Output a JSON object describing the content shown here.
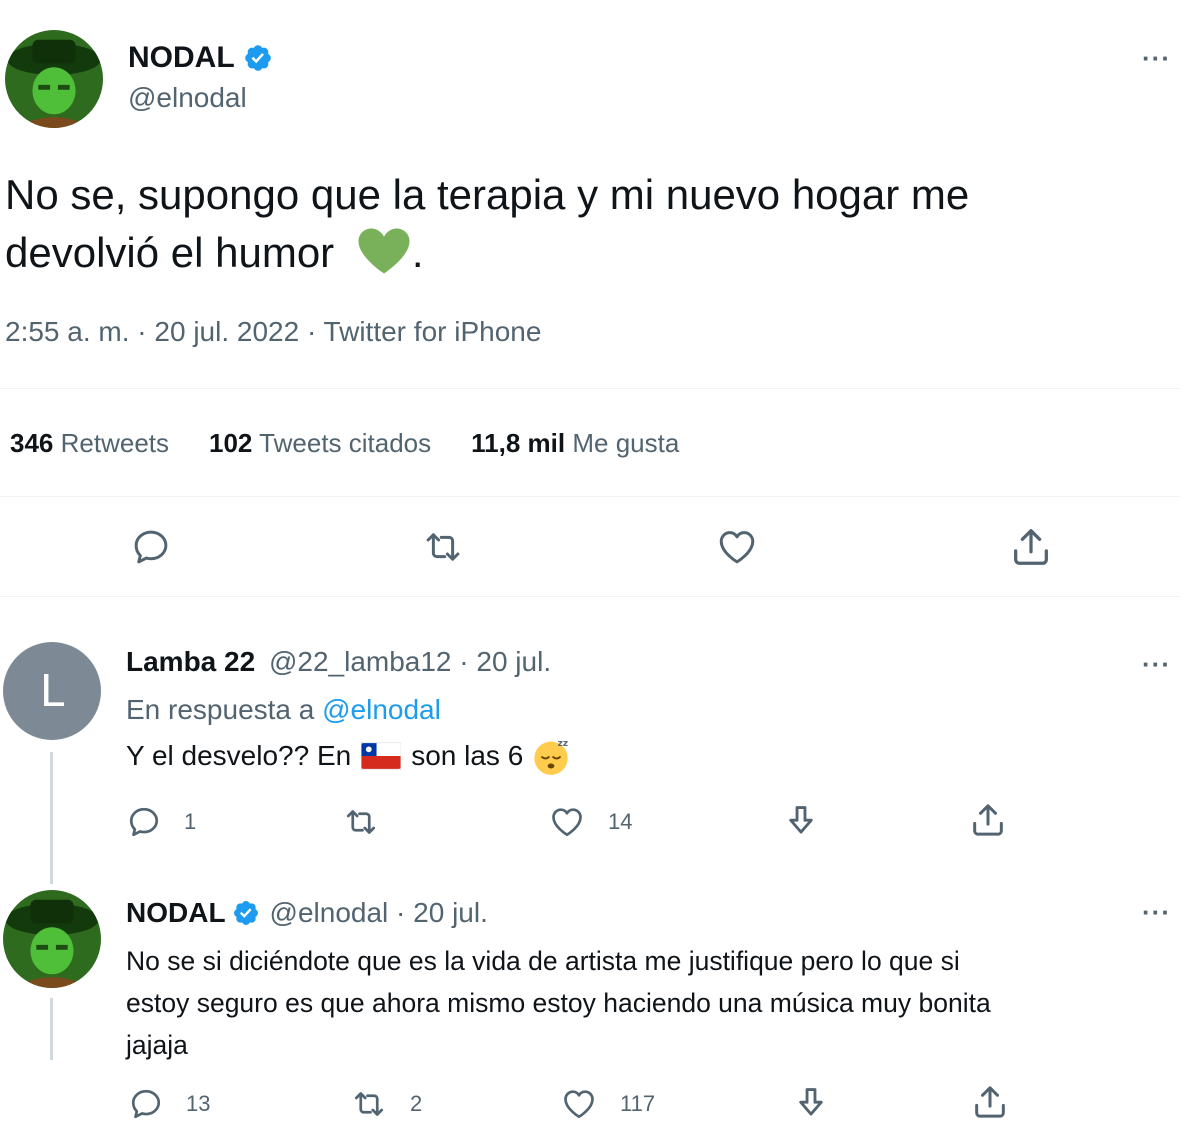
{
  "main_tweet": {
    "display_name": "NODAL",
    "handle": "@elnodal",
    "text_line1": "No se, supongo que la terapia y mi nuevo hogar me",
    "text_line2": "devolvió el humor",
    "text_emoji": "green-heart",
    "text_end": ".",
    "meta": "2:55 a. m. · 20 jul. 2022 · Twitter for iPhone",
    "stats": {
      "retweets_count": "346",
      "retweets_label": "Retweets",
      "quotes_count": "102",
      "quotes_label": "Tweets citados",
      "likes_count": "11,8 mil",
      "likes_label": "Me gusta"
    },
    "actions": [
      "reply-icon",
      "retweet-icon",
      "like-icon",
      "share-icon"
    ]
  },
  "reply1": {
    "avatar_letter": "L",
    "display_name": "Lamba 22",
    "handle_date": "@22_lamba12 · 20 jul.",
    "reply_prefix": "En respuesta a",
    "reply_to": "@elnodal",
    "text_a": "Y el desvelo?? En",
    "text_flag": "chile-flag",
    "text_b": "son las 6",
    "text_emoji": "sleeping-face",
    "reply_count": "1",
    "retweet_count": "",
    "like_count": "14"
  },
  "reply2": {
    "display_name": "NODAL",
    "handle_date": "@elnodal · 20 jul.",
    "text_line1": "No se si diciéndote que es la vida de artista me justifique pero lo que si",
    "text_line2": "estoy seguro es que ahora mismo estoy haciendo una música muy bonita",
    "text_line3": "jajaja",
    "reply_count": "13",
    "retweet_count": "2",
    "like_count": "117"
  },
  "colors": {
    "verified": "#1d9bf0",
    "link": "#1d9bf0",
    "muted": "#536471",
    "heart_emoji": "#78b159"
  }
}
